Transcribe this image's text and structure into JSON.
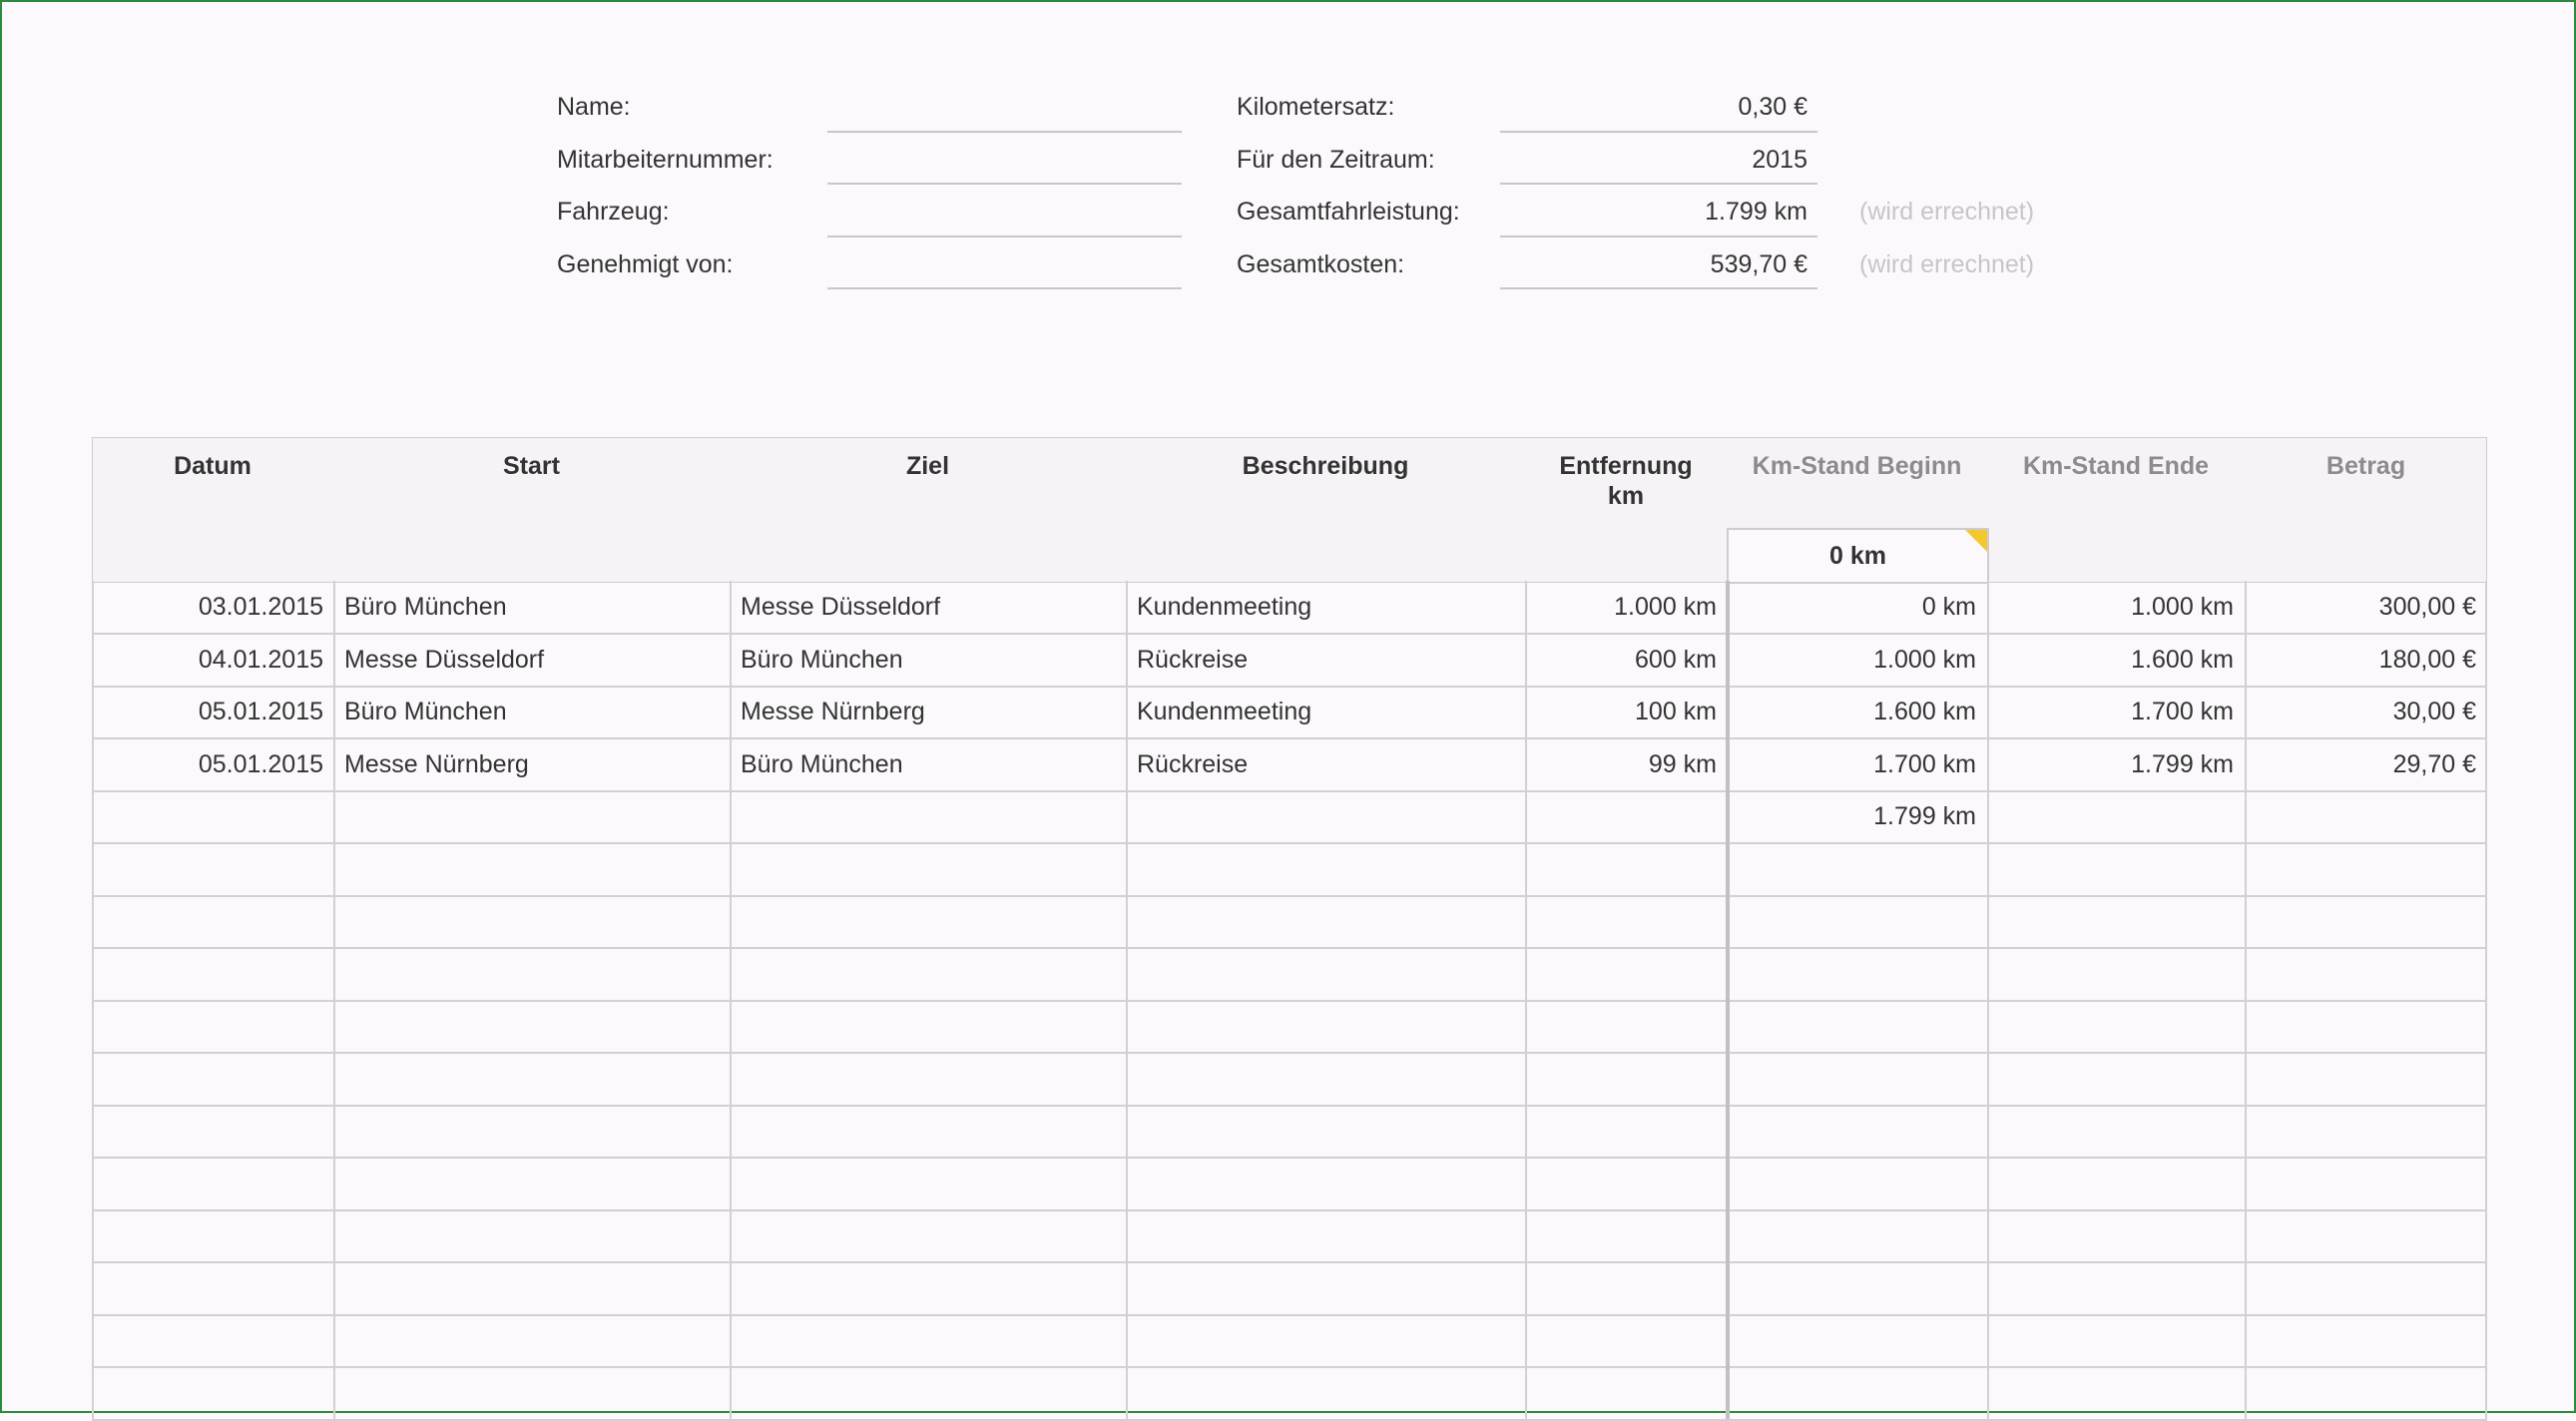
{
  "header": {
    "left": [
      {
        "label": "Name:",
        "value": ""
      },
      {
        "label": "Mitarbeiternummer:",
        "value": ""
      },
      {
        "label": "Fahrzeug:",
        "value": ""
      },
      {
        "label": "Genehmigt von:",
        "value": ""
      }
    ],
    "right": [
      {
        "label": "Kilometersatz:",
        "value": "0,30 €",
        "note": ""
      },
      {
        "label": "Für den Zeitraum:",
        "value": "2015",
        "note": ""
      },
      {
        "label": "Gesamtfahrleistung:",
        "value": "1.799 km",
        "note": "(wird errechnet)"
      },
      {
        "label": "Gesamtkosten:",
        "value": "539,70 €",
        "note": "(wird errechnet)"
      }
    ]
  },
  "table": {
    "columns": {
      "datum": "Datum",
      "start": "Start",
      "ziel": "Ziel",
      "beschreibung": "Beschreibung",
      "entfernung_line1": "Entfernung",
      "entfernung_line2": "km",
      "km_beginn": "Km-Stand Beginn",
      "km_ende": "Km-Stand Ende",
      "betrag": "Betrag"
    },
    "initial_km": "0 km",
    "rows": [
      {
        "datum": "03.01.2015",
        "start": "Büro München",
        "ziel": "Messe Düsseldorf",
        "beschreibung": "Kundenmeeting",
        "entfernung": "1.000 km",
        "km_beginn": "0 km",
        "km_ende": "1.000 km",
        "betrag": "300,00 €"
      },
      {
        "datum": "04.01.2015",
        "start": "Messe Düsseldorf",
        "ziel": "Büro München",
        "beschreibung": "Rückreise",
        "entfernung": "600 km",
        "km_beginn": "1.000 km",
        "km_ende": "1.600 km",
        "betrag": "180,00 €"
      },
      {
        "datum": "05.01.2015",
        "start": "Büro München",
        "ziel": "Messe Nürnberg",
        "beschreibung": "Kundenmeeting",
        "entfernung": "100 km",
        "km_beginn": "1.600 km",
        "km_ende": "1.700 km",
        "betrag": "30,00 €"
      },
      {
        "datum": "05.01.2015",
        "start": "Messe Nürnberg",
        "ziel": "Büro München",
        "beschreibung": "Rückreise",
        "entfernung": "99 km",
        "km_beginn": "1.700 km",
        "km_ende": "1.799 km",
        "betrag": "29,70 €"
      },
      {
        "datum": "",
        "start": "",
        "ziel": "",
        "beschreibung": "",
        "entfernung": "",
        "km_beginn": "1.799 km",
        "km_ende": "",
        "betrag": ""
      },
      {
        "datum": "",
        "start": "",
        "ziel": "",
        "beschreibung": "",
        "entfernung": "",
        "km_beginn": "",
        "km_ende": "",
        "betrag": ""
      },
      {
        "datum": "",
        "start": "",
        "ziel": "",
        "beschreibung": "",
        "entfernung": "",
        "km_beginn": "",
        "km_ende": "",
        "betrag": ""
      },
      {
        "datum": "",
        "start": "",
        "ziel": "",
        "beschreibung": "",
        "entfernung": "",
        "km_beginn": "",
        "km_ende": "",
        "betrag": ""
      },
      {
        "datum": "",
        "start": "",
        "ziel": "",
        "beschreibung": "",
        "entfernung": "",
        "km_beginn": "",
        "km_ende": "",
        "betrag": ""
      },
      {
        "datum": "",
        "start": "",
        "ziel": "",
        "beschreibung": "",
        "entfernung": "",
        "km_beginn": "",
        "km_ende": "",
        "betrag": ""
      },
      {
        "datum": "",
        "start": "",
        "ziel": "",
        "beschreibung": "",
        "entfernung": "",
        "km_beginn": "",
        "km_ende": "",
        "betrag": ""
      },
      {
        "datum": "",
        "start": "",
        "ziel": "",
        "beschreibung": "",
        "entfernung": "",
        "km_beginn": "",
        "km_ende": "",
        "betrag": ""
      },
      {
        "datum": "",
        "start": "",
        "ziel": "",
        "beschreibung": "",
        "entfernung": "",
        "km_beginn": "",
        "km_ende": "",
        "betrag": ""
      },
      {
        "datum": "",
        "start": "",
        "ziel": "",
        "beschreibung": "",
        "entfernung": "",
        "km_beginn": "",
        "km_ende": "",
        "betrag": ""
      },
      {
        "datum": "",
        "start": "",
        "ziel": "",
        "beschreibung": "",
        "entfernung": "",
        "km_beginn": "",
        "km_ende": "",
        "betrag": ""
      },
      {
        "datum": "",
        "start": "",
        "ziel": "",
        "beschreibung": "",
        "entfernung": "",
        "km_beginn": "",
        "km_ende": "",
        "betrag": ""
      }
    ]
  },
  "colors": {
    "accent_corner": "#f2c830",
    "frame_border": "#2b8a3e",
    "muted_header": "#8e8a90",
    "note_text": "#c8c4cb"
  }
}
